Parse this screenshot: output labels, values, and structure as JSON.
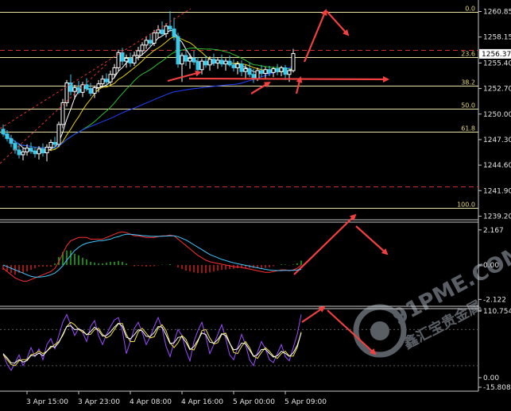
{
  "chart_data": {
    "type": "candlestick",
    "watermark": {
      "text": "91PME.COM",
      "subtext": "鑫汇宝贵金属"
    },
    "price_axis": {
      "ticks": [
        "1260.85",
        "1258.15",
        "1255.40",
        "1252.70",
        "1250.00",
        "1247.30",
        "1244.60",
        "1241.90",
        "1239.20"
      ],
      "ylim": [
        1238.9,
        1261.9
      ],
      "current_price": "1256.37"
    },
    "fibonacci": [
      {
        "level": "0.0",
        "price": 1260.85
      },
      {
        "level": "23.6",
        "price": 1256.0
      },
      {
        "level": "38.2",
        "price": 1253.0
      },
      {
        "level": "50.0",
        "price": 1250.55
      },
      {
        "level": "61.8",
        "price": 1248.15
      },
      {
        "level": "100.0",
        "price": 1240.05
      }
    ],
    "resistance_lines": [
      1256.8,
      1242.3
    ],
    "time_axis": {
      "labels": [
        "3 Apr 15:00",
        "3 Apr 23:00",
        "4 Apr 08:00",
        "4 Apr 16:00",
        "5 Apr 00:00",
        "5 Apr 09:00"
      ],
      "label_indices": [
        6,
        19,
        32,
        45,
        58,
        71
      ]
    },
    "candles": [
      {
        "o": 1248.4,
        "h": 1248.9,
        "l": 1247.6,
        "c": 1247.9
      },
      {
        "o": 1247.9,
        "h": 1248.3,
        "l": 1247.1,
        "c": 1247.4
      },
      {
        "o": 1247.4,
        "h": 1247.8,
        "l": 1246.5,
        "c": 1246.9
      },
      {
        "o": 1246.9,
        "h": 1247.2,
        "l": 1245.8,
        "c": 1246.2
      },
      {
        "o": 1246.2,
        "h": 1246.9,
        "l": 1245.3,
        "c": 1245.7
      },
      {
        "o": 1245.7,
        "h": 1246.4,
        "l": 1245.1,
        "c": 1246.0
      },
      {
        "o": 1246.0,
        "h": 1246.8,
        "l": 1245.6,
        "c": 1246.4
      },
      {
        "o": 1246.4,
        "h": 1247.0,
        "l": 1245.8,
        "c": 1246.1
      },
      {
        "o": 1246.1,
        "h": 1246.5,
        "l": 1245.4,
        "c": 1245.8
      },
      {
        "o": 1245.8,
        "h": 1246.6,
        "l": 1245.2,
        "c": 1246.3
      },
      {
        "o": 1246.3,
        "h": 1246.9,
        "l": 1245.5,
        "c": 1245.9
      },
      {
        "o": 1245.9,
        "h": 1246.8,
        "l": 1245.0,
        "c": 1246.5
      },
      {
        "o": 1246.5,
        "h": 1247.3,
        "l": 1246.1,
        "c": 1247.0
      },
      {
        "o": 1247.0,
        "h": 1247.6,
        "l": 1246.3,
        "c": 1246.8
      },
      {
        "o": 1246.8,
        "h": 1249.2,
        "l": 1246.5,
        "c": 1248.9
      },
      {
        "o": 1248.9,
        "h": 1251.6,
        "l": 1248.5,
        "c": 1251.2
      },
      {
        "o": 1251.2,
        "h": 1253.6,
        "l": 1250.8,
        "c": 1253.3
      },
      {
        "o": 1253.3,
        "h": 1254.2,
        "l": 1252.0,
        "c": 1252.4
      },
      {
        "o": 1252.4,
        "h": 1253.1,
        "l": 1251.6,
        "c": 1252.8
      },
      {
        "o": 1252.8,
        "h": 1253.5,
        "l": 1252.1,
        "c": 1252.3
      },
      {
        "o": 1252.3,
        "h": 1253.4,
        "l": 1251.8,
        "c": 1253.1
      },
      {
        "o": 1253.1,
        "h": 1253.8,
        "l": 1252.4,
        "c": 1252.7
      },
      {
        "o": 1252.7,
        "h": 1253.3,
        "l": 1251.9,
        "c": 1252.2
      },
      {
        "o": 1252.2,
        "h": 1253.0,
        "l": 1251.7,
        "c": 1252.8
      },
      {
        "o": 1252.8,
        "h": 1253.6,
        "l": 1252.3,
        "c": 1253.2
      },
      {
        "o": 1253.2,
        "h": 1254.1,
        "l": 1252.8,
        "c": 1253.7
      },
      {
        "o": 1253.7,
        "h": 1254.3,
        "l": 1253.0,
        "c": 1253.4
      },
      {
        "o": 1253.4,
        "h": 1254.6,
        "l": 1253.1,
        "c": 1254.2
      },
      {
        "o": 1254.2,
        "h": 1255.3,
        "l": 1253.8,
        "c": 1254.9
      },
      {
        "o": 1254.9,
        "h": 1256.8,
        "l": 1254.5,
        "c": 1256.5
      },
      {
        "o": 1256.5,
        "h": 1257.0,
        "l": 1255.2,
        "c": 1255.6
      },
      {
        "o": 1255.6,
        "h": 1256.3,
        "l": 1254.9,
        "c": 1255.9
      },
      {
        "o": 1255.9,
        "h": 1256.5,
        "l": 1255.0,
        "c": 1255.4
      },
      {
        "o": 1255.4,
        "h": 1256.6,
        "l": 1255.1,
        "c": 1256.2
      },
      {
        "o": 1256.2,
        "h": 1257.1,
        "l": 1255.7,
        "c": 1256.7
      },
      {
        "o": 1256.7,
        "h": 1257.6,
        "l": 1256.2,
        "c": 1257.3
      },
      {
        "o": 1257.3,
        "h": 1258.2,
        "l": 1256.9,
        "c": 1257.8
      },
      {
        "o": 1257.8,
        "h": 1258.5,
        "l": 1257.1,
        "c": 1257.5
      },
      {
        "o": 1257.5,
        "h": 1258.9,
        "l": 1257.2,
        "c": 1258.6
      },
      {
        "o": 1258.6,
        "h": 1259.4,
        "l": 1258.0,
        "c": 1258.9
      },
      {
        "o": 1258.9,
        "h": 1259.8,
        "l": 1258.2,
        "c": 1258.5
      },
      {
        "o": 1258.5,
        "h": 1259.6,
        "l": 1258.1,
        "c": 1259.3
      },
      {
        "o": 1259.3,
        "h": 1260.9,
        "l": 1258.7,
        "c": 1259.0
      },
      {
        "o": 1259.0,
        "h": 1260.2,
        "l": 1257.8,
        "c": 1258.2
      },
      {
        "o": 1258.2,
        "h": 1258.6,
        "l": 1254.9,
        "c": 1255.3
      },
      {
        "o": 1255.3,
        "h": 1256.5,
        "l": 1253.4,
        "c": 1256.2
      },
      {
        "o": 1256.2,
        "h": 1256.9,
        "l": 1255.1,
        "c": 1255.6
      },
      {
        "o": 1255.6,
        "h": 1256.4,
        "l": 1254.8,
        "c": 1255.9
      },
      {
        "o": 1255.9,
        "h": 1256.7,
        "l": 1255.2,
        "c": 1255.5
      },
      {
        "o": 1255.5,
        "h": 1256.0,
        "l": 1254.3,
        "c": 1254.7
      },
      {
        "o": 1254.7,
        "h": 1255.9,
        "l": 1254.2,
        "c": 1255.6
      },
      {
        "o": 1255.6,
        "h": 1256.2,
        "l": 1254.9,
        "c": 1255.2
      },
      {
        "o": 1255.2,
        "h": 1256.1,
        "l": 1254.6,
        "c": 1255.8
      },
      {
        "o": 1255.8,
        "h": 1256.4,
        "l": 1255.1,
        "c": 1255.4
      },
      {
        "o": 1255.4,
        "h": 1256.0,
        "l": 1254.8,
        "c": 1255.7
      },
      {
        "o": 1255.7,
        "h": 1256.3,
        "l": 1255.0,
        "c": 1255.3
      },
      {
        "o": 1255.3,
        "h": 1255.9,
        "l": 1254.6,
        "c": 1255.6
      },
      {
        "o": 1255.6,
        "h": 1256.2,
        "l": 1255.0,
        "c": 1255.2
      },
      {
        "o": 1255.2,
        "h": 1255.8,
        "l": 1254.5,
        "c": 1254.9
      },
      {
        "o": 1254.9,
        "h": 1255.6,
        "l": 1254.2,
        "c": 1255.3
      },
      {
        "o": 1255.3,
        "h": 1255.7,
        "l": 1254.0,
        "c": 1254.5
      },
      {
        "o": 1254.5,
        "h": 1255.2,
        "l": 1253.8,
        "c": 1254.8
      },
      {
        "o": 1254.8,
        "h": 1255.4,
        "l": 1253.9,
        "c": 1254.2
      },
      {
        "o": 1254.2,
        "h": 1254.8,
        "l": 1253.3,
        "c": 1253.7
      },
      {
        "o": 1253.7,
        "h": 1254.9,
        "l": 1253.5,
        "c": 1254.6
      },
      {
        "o": 1254.6,
        "h": 1255.2,
        "l": 1253.9,
        "c": 1254.3
      },
      {
        "o": 1254.3,
        "h": 1255.0,
        "l": 1253.8,
        "c": 1254.7
      },
      {
        "o": 1254.7,
        "h": 1255.1,
        "l": 1254.0,
        "c": 1254.4
      },
      {
        "o": 1254.4,
        "h": 1255.0,
        "l": 1253.9,
        "c": 1254.8
      },
      {
        "o": 1254.8,
        "h": 1255.3,
        "l": 1254.1,
        "c": 1254.5
      },
      {
        "o": 1254.5,
        "h": 1255.1,
        "l": 1254.0,
        "c": 1254.9
      },
      {
        "o": 1254.9,
        "h": 1255.2,
        "l": 1253.6,
        "c": 1254.2
      },
      {
        "o": 1254.2,
        "h": 1254.8,
        "l": 1253.4,
        "c": 1254.6
      },
      {
        "o": 1254.6,
        "h": 1256.9,
        "l": 1254.4,
        "c": 1256.4
      }
    ],
    "macd": {
      "ticks": [
        "2.167",
        "0.00",
        "-2.122"
      ],
      "ylim": [
        -2.4,
        2.5
      ],
      "line": [
        -0.2,
        -0.4,
        -0.6,
        -0.8,
        -0.9,
        -1.0,
        -1.0,
        -0.9,
        -0.8,
        -0.7,
        -0.6,
        -0.5,
        -0.4,
        -0.2,
        0.2,
        0.7,
        1.2,
        1.5,
        1.6,
        1.7,
        1.7,
        1.7,
        1.6,
        1.6,
        1.6,
        1.6,
        1.7,
        1.8,
        1.9,
        2.0,
        2.05,
        2.0,
        1.9,
        1.8,
        1.8,
        1.75,
        1.7,
        1.7,
        1.7,
        1.75,
        1.8,
        1.8,
        1.85,
        1.8,
        1.6,
        1.4,
        1.2,
        1.0,
        0.8,
        0.6,
        0.45,
        0.3,
        0.2,
        0.15,
        0.1,
        0.05,
        0.0,
        -0.05,
        -0.1,
        -0.12,
        -0.15,
        -0.2,
        -0.25,
        -0.3,
        -0.35,
        -0.4,
        -0.45,
        -0.45,
        -0.4,
        -0.35,
        -0.3,
        -0.3,
        -0.35,
        -0.3,
        -0.2,
        0.0
      ],
      "signal": [
        0.0,
        -0.1,
        -0.2,
        -0.3,
        -0.4,
        -0.5,
        -0.6,
        -0.7,
        -0.75,
        -0.75,
        -0.72,
        -0.68,
        -0.6,
        -0.5,
        -0.3,
        -0.05,
        0.3,
        0.6,
        0.9,
        1.1,
        1.25,
        1.35,
        1.4,
        1.45,
        1.5,
        1.5,
        1.55,
        1.6,
        1.7,
        1.75,
        1.85,
        1.9,
        1.9,
        1.88,
        1.85,
        1.82,
        1.8,
        1.78,
        1.77,
        1.77,
        1.78,
        1.79,
        1.8,
        1.8,
        1.75,
        1.65,
        1.55,
        1.4,
        1.25,
        1.1,
        0.95,
        0.8,
        0.65,
        0.55,
        0.45,
        0.35,
        0.28,
        0.2,
        0.14,
        0.08,
        0.03,
        -0.02,
        -0.07,
        -0.12,
        -0.17,
        -0.22,
        -0.27,
        -0.31,
        -0.33,
        -0.34,
        -0.34,
        -0.33,
        -0.33,
        -0.33,
        -0.31,
        -0.27
      ],
      "histogram": [
        -0.3,
        -0.4,
        -0.5,
        -0.6,
        -0.5,
        -0.5,
        -0.4,
        -0.3,
        -0.2,
        -0.1,
        -0.1,
        -0.1,
        -0.1,
        0.1,
        0.5,
        0.8,
        0.9,
        0.9,
        0.7,
        0.6,
        0.45,
        0.35,
        0.2,
        0.15,
        0.1,
        0.1,
        0.15,
        0.2,
        0.2,
        0.25,
        0.2,
        0.1,
        0.0,
        -0.08,
        -0.05,
        -0.07,
        -0.1,
        -0.08,
        -0.07,
        -0.02,
        0.02,
        0.01,
        0.05,
        0.0,
        -0.15,
        -0.25,
        -0.35,
        -0.4,
        -0.45,
        -0.5,
        -0.5,
        -0.5,
        -0.45,
        -0.4,
        -0.35,
        -0.3,
        -0.28,
        -0.25,
        -0.24,
        -0.2,
        -0.18,
        -0.18,
        -0.18,
        -0.18,
        -0.18,
        -0.18,
        -0.18,
        -0.14,
        -0.07,
        -0.01,
        0.04,
        0.03,
        -0.02,
        0.03,
        0.11,
        0.27
      ]
    },
    "stochastic": {
      "ticks": [
        "110.7549",
        "0.00",
        "-15.8081"
      ],
      "ylim": [
        -15.8081,
        110.7549
      ],
      "k": [
        40,
        22,
        12,
        25,
        38,
        20,
        32,
        50,
        35,
        48,
        30,
        55,
        65,
        48,
        70,
        92,
        105,
        88,
        70,
        82,
        75,
        60,
        85,
        95,
        70,
        55,
        72,
        85,
        96,
        100,
        78,
        40,
        60,
        82,
        92,
        75,
        55,
        68,
        85,
        100,
        82,
        52,
        35,
        60,
        80,
        70,
        45,
        28,
        60,
        78,
        92,
        68,
        40,
        55,
        72,
        88,
        65,
        38,
        30,
        50,
        72,
        55,
        30,
        20,
        42,
        60,
        48,
        30,
        25,
        40,
        55,
        35,
        28,
        50,
        72,
        105
      ],
      "d": [
        38,
        30,
        22,
        20,
        28,
        30,
        30,
        38,
        40,
        44,
        40,
        44,
        50,
        55,
        60,
        70,
        85,
        92,
        88,
        80,
        76,
        72,
        72,
        80,
        82,
        72,
        66,
        70,
        80,
        90,
        90,
        72,
        60,
        60,
        76,
        82,
        74,
        66,
        68,
        82,
        88,
        78,
        58,
        50,
        58,
        70,
        64,
        48,
        46,
        60,
        78,
        80,
        66,
        56,
        58,
        72,
        74,
        58,
        42,
        40,
        52,
        60,
        50,
        36,
        32,
        42,
        50,
        44,
        36,
        32,
        40,
        44,
        36,
        36,
        50,
        76
      ],
      "levels": [
        80,
        20
      ]
    }
  }
}
